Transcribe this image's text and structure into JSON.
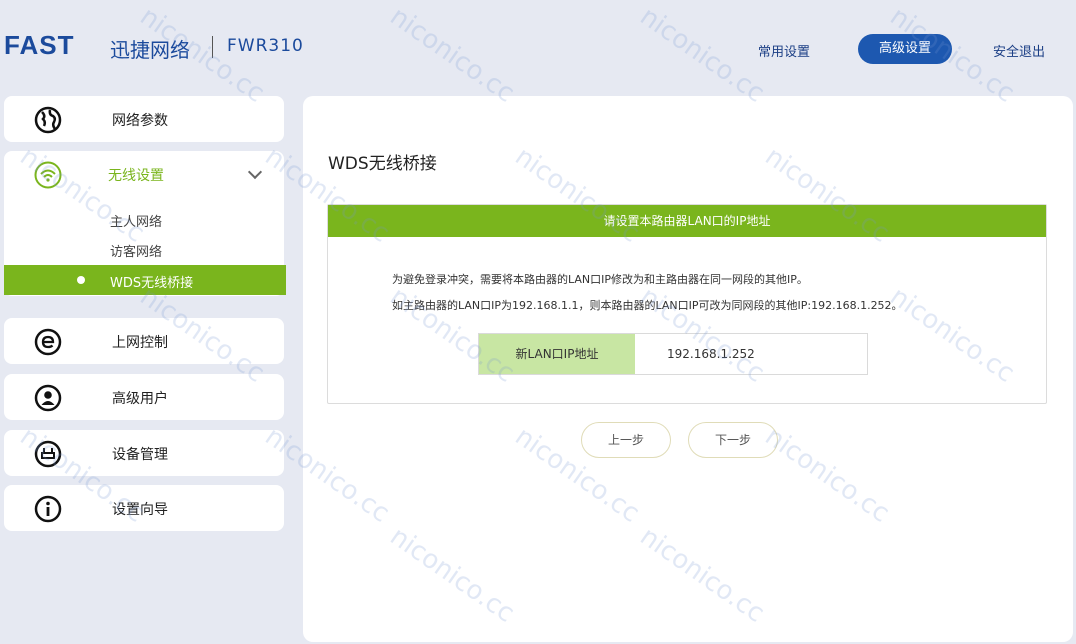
{
  "header": {
    "brand": "FAST",
    "brand_cn": "迅捷网络",
    "model": "FWR310",
    "nav_common": "常用设置",
    "nav_advanced": "高级设置",
    "nav_logout": "安全退出"
  },
  "sidebar": {
    "network_params": "网络参数",
    "wireless": "无线设置",
    "wireless_sub": [
      "主人网络",
      "访客网络",
      "WDS无线桥接"
    ],
    "internet_control": "上网控制",
    "advanced_users": "高级用户",
    "device_mgmt": "设备管理",
    "setup_wizard": "设置向导"
  },
  "main": {
    "title": "WDS无线桥接",
    "card_header": "请设置本路由器LAN口的IP地址",
    "desc_line1": "为避免登录冲突，需要将本路由器的LAN口IP修改为和主路由器在同一网段的其他IP。",
    "desc_line2": "如主路由器的LAN口IP为192.168.1.1，则本路由器的LAN口IP可改为同网段的其他IP:192.168.1.252。",
    "field_label": "新LAN口IP地址",
    "field_value": "192.168.1.252",
    "btn_prev": "上一步",
    "btn_next": "下一步"
  },
  "watermark": "niconico.cc",
  "colors": {
    "accent_green": "#7ab51d",
    "brand_blue": "#1d58b0",
    "background": "#e6e9f2"
  }
}
